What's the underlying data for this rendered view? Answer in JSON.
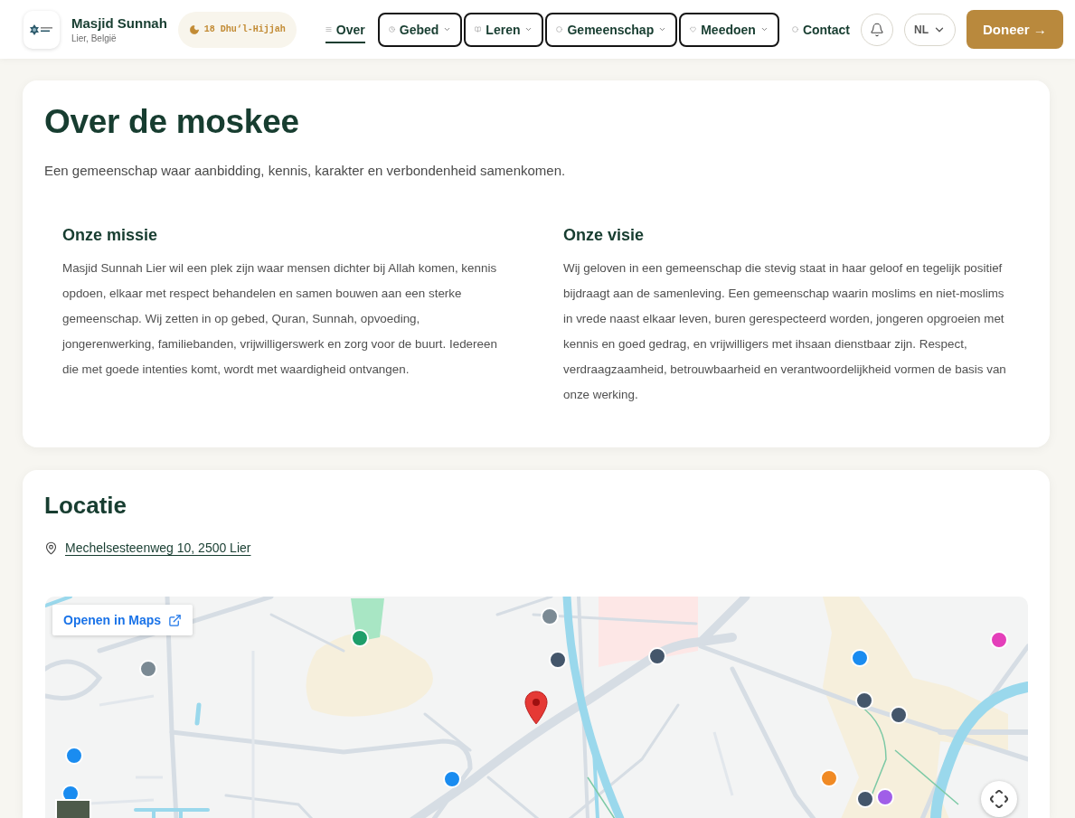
{
  "header": {
    "brand": {
      "name": "Masjid Sunnah",
      "location": "Lier, België"
    },
    "hijri_date": "18 Dhu‘l-Hijjah",
    "nav": [
      {
        "label": "Over",
        "kind": "link",
        "selected": true
      },
      {
        "label": "Gebed",
        "kind": "dropdown",
        "selected": false
      },
      {
        "label": "Leren",
        "kind": "dropdown",
        "selected": false
      },
      {
        "label": "Gemeenschap",
        "kind": "dropdown",
        "selected": false
      },
      {
        "label": "Meedoen",
        "kind": "dropdown",
        "selected": false
      },
      {
        "label": "Contact",
        "kind": "link",
        "selected": false
      }
    ],
    "language": "NL",
    "donate_button": "Doneer →"
  },
  "about": {
    "title": "Over de moskee",
    "intro": "Een gemeenschap waar aanbidding, kennis, karakter en verbondenheid samenkomen.",
    "columns": [
      {
        "heading": "Onze missie",
        "text": "Masjid Sunnah Lier wil een plek zijn waar mensen dichter bij Allah komen, kennis opdoen, elkaar met respect behandelen en samen bouwen aan een sterke gemeenschap. Wij zetten in op gebed, Quran, Sunnah, opvoeding, jongerenwerking, familiebanden, vrijwilligerswerk en zorg voor de buurt. Iedereen die met goede intenties komt, wordt met waardigheid ontvangen."
      },
      {
        "heading": "Onze visie",
        "text": "Wij geloven in een gemeenschap die stevig staat in haar geloof en tegelijk positief bijdraagt aan de samenleving. Een gemeenschap waarin moslims en niet-moslims in vrede naast elkaar leven, buren gerespecteerd worden, jongeren opgroeien met kennis en goed gedrag, en vrijwilligers met ihsaan dienstbaar zijn. Respect, verdraagzaamheid, betrouwbaarheid en verantwoordelijkheid vormen de basis van onze werking."
      }
    ]
  },
  "location": {
    "title": "Locatie",
    "address": "Mechelsesteenweg 10, 2500 Lier",
    "map": {
      "open_button": "Openen in Maps"
    }
  }
}
